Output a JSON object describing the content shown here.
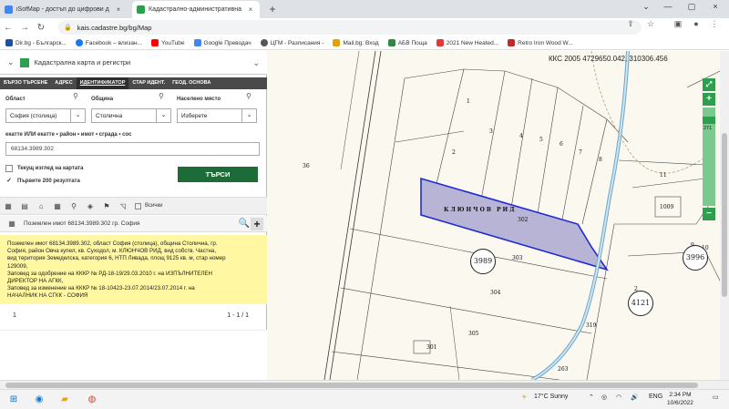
{
  "tabs": [
    {
      "title": "iSofMap - достъп до цифрови д",
      "close": "×"
    },
    {
      "title": "Кадастрално-административна",
      "close": "×"
    }
  ],
  "new_tab": "+",
  "window_controls": [
    "⌄",
    "—",
    "▢",
    "×"
  ],
  "nav": {
    "back": "←",
    "forward": "→",
    "reload": "↻",
    "url": "kais.cadastre.bg/bg/Map",
    "lock": "🔒",
    "share": "⇪",
    "star": "☆",
    "ext": "▣",
    "profile": "●",
    "menu": "⋮"
  },
  "bookmarks": [
    {
      "label": "Dir.bg - Българск...",
      "color": "#1f4fa3"
    },
    {
      "label": "Facebook – влизан...",
      "color": "#1877f2"
    },
    {
      "label": "YouTube",
      "color": "#ff0000"
    },
    {
      "label": "Google Преводач",
      "color": "#4285f4"
    },
    {
      "label": "ЦГМ - Разписания -",
      "color": "#555555"
    },
    {
      "label": "Mail.bg: Вход",
      "color": "#e6a000"
    },
    {
      "label": "АБВ Поща",
      "color": "#2b8a3e"
    },
    {
      "label": "2021 New Heated...",
      "color": "#e53935"
    },
    {
      "label": "Retro Iron Wood W...",
      "color": "#c62828"
    }
  ],
  "panel": {
    "header_title": "Кадастрална карта и регистри",
    "tabs": [
      "БЪРЗО ТЪРСЕНЕ",
      "АДРЕС",
      "ИДЕНТИФИКАТОР",
      "СТАР ИДЕНТ.",
      "ГЕОД. ОСНОВА"
    ],
    "labels": {
      "oblast": "Област",
      "obshtina": "Община",
      "naseleno": "Населено място"
    },
    "selects": {
      "oblast": "София (столица)",
      "obshtina": "Столична",
      "naseleno": "Изберете"
    },
    "ident_label": "екатте ИЛИ екатте • район • имот • сграда • сос",
    "ident_value": "68134.3989.302",
    "checkbox_current": "Текущ изглед на картата",
    "checkbox_first200": "Първите 200 резултата",
    "search_button": "ТЪРСИ",
    "all_label": "Всички",
    "result_title": "Поземлен имот 68134.3989.302 гр. София",
    "info_lines": [
      "Поземлен имот 68134.3989.302, област София (столица), община Столична, гр.",
      "София, район Овча купел, кв. Суходол, м. КЛЮНЧОВ РИД, вид собств. Частна,",
      "вид територия Земеделска, категория 6, НТП Ливада, площ 9125 кв. м, стар номер",
      "129009,",
      "Заповед за одобрение на КККР № РД-18-19/29.03.2010 г. на ИЗПЪЛНИТЕЛЕН",
      "ДИРЕКТОР НА АГКК,",
      "Заповед за изменение на КККР № 18-10423-23.07.2014/23.07.2014 г. на",
      "НАЧАЛНИК НА СГКК - СОФИЯ"
    ],
    "page_num": "1",
    "page_range": "1 - 1 / 1"
  },
  "map": {
    "coord_text": "ККС 2005 4729650.042, 310306.456",
    "zoom_level_label": "271",
    "locality": "КЛЮНЧОВ РИД",
    "parcel_numbers": [
      "1",
      "2",
      "3",
      "4",
      "5",
      "6",
      "7",
      "8",
      "11",
      "1009",
      "36",
      "302",
      "303",
      "304",
      "305",
      "301",
      "319",
      "263",
      "9",
      "10",
      "2"
    ],
    "block_labels": [
      "3989",
      "3996",
      "4121"
    ],
    "highlight_color": "#b8b4d6",
    "highlight_stroke": "#1f2ad6"
  },
  "taskbar": {
    "weather": "17°C  Sunny",
    "lang": "ENG",
    "time": "2:34 PM",
    "date": "10/6/2022"
  }
}
